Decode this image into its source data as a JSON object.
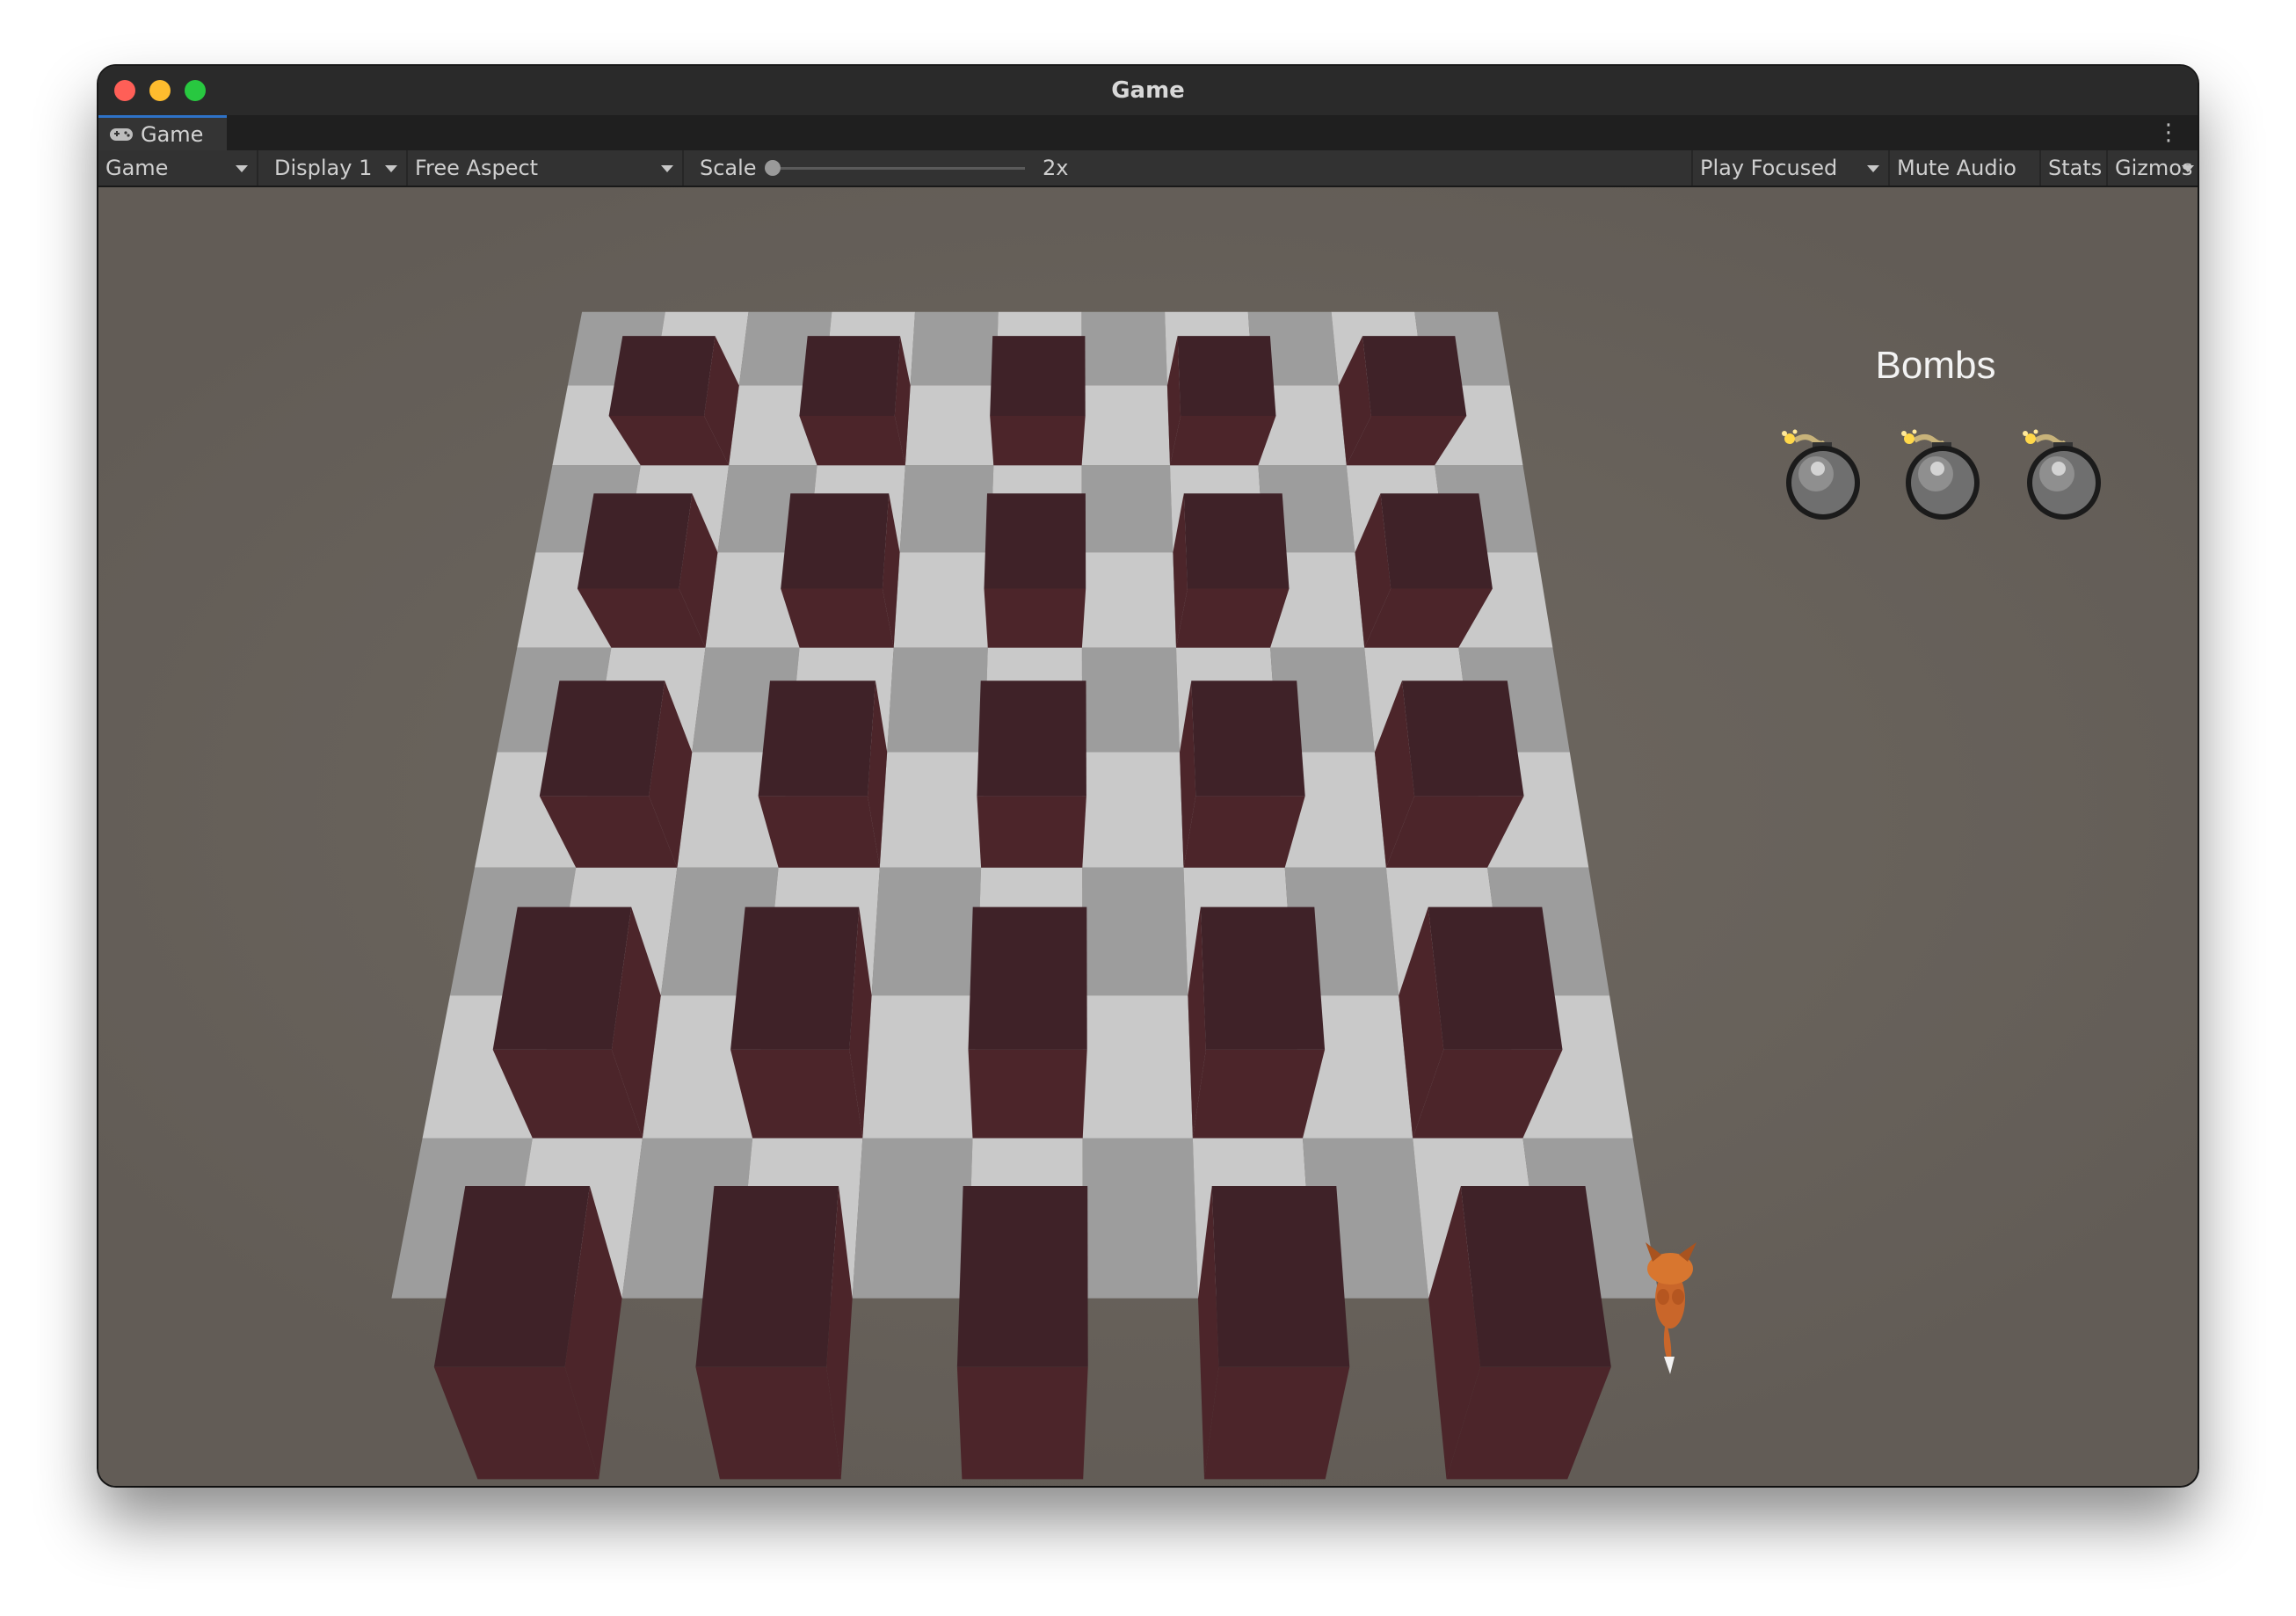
{
  "window": {
    "title": "Game",
    "close_color": "#ff5f57",
    "minimize_color": "#febc2e",
    "zoom_color": "#28c840"
  },
  "tab": {
    "icon": "gamepad-icon",
    "label": "Game"
  },
  "toolbar": {
    "view_select": "Game",
    "display_select": "Display 1",
    "aspect_select": "Free Aspect",
    "scale_label": "Scale",
    "scale_value": "2x",
    "scale_slider_fraction": 0.0,
    "play_mode_select": "Play Focused",
    "mute_audio": "Mute Audio",
    "stats": "Stats",
    "gizmos": "Gizmos"
  },
  "hud": {
    "bombs_label": "Bombs",
    "bombs_count": 3,
    "bomb_icon": "bomb-icon"
  },
  "scene": {
    "board": {
      "columns": 11,
      "rows": 9
    },
    "wall_columns": 5,
    "wall_rows": 5,
    "floor_light": "#c9c9c9",
    "floor_dark": "#9d9d9d",
    "wall_top": "#3f2228",
    "wall_side": "#4c252a",
    "player_icon": "fox-icon"
  }
}
